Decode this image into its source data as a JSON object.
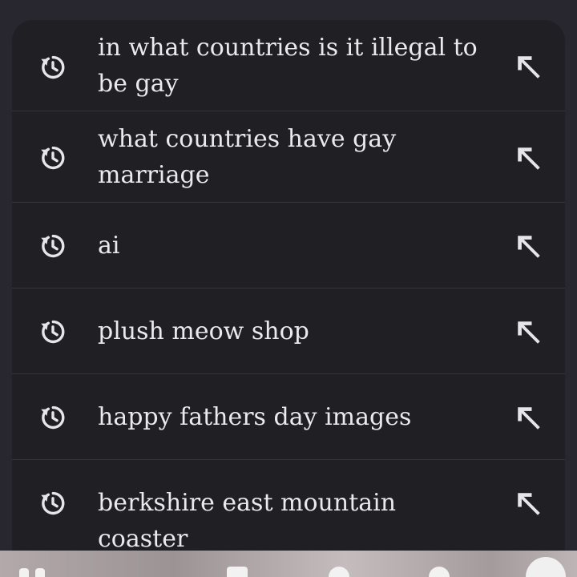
{
  "suggestions": [
    {
      "text_line1": "in what countries is it illegal to",
      "text_line2": "be gay",
      "history_icon": "history-icon",
      "fill_icon": "arrow-up-left-icon"
    },
    {
      "text_line1": "what countries have gay",
      "text_line2": "marriage",
      "history_icon": "history-icon",
      "fill_icon": "arrow-up-left-icon"
    },
    {
      "text_line1": "ai",
      "text_line2": "",
      "history_icon": "history-icon",
      "fill_icon": "arrow-up-left-icon"
    },
    {
      "text_line1": "plush meow shop",
      "text_line2": "",
      "history_icon": "history-icon",
      "fill_icon": "arrow-up-left-icon"
    },
    {
      "text_line1": "happy fathers day images",
      "text_line2": "",
      "history_icon": "history-icon",
      "fill_icon": "arrow-up-left-icon"
    },
    {
      "text_line1": "berkshire east mountain coaster",
      "text_line2": "",
      "history_icon": "history-icon",
      "fill_icon": "arrow-up-left-icon"
    }
  ],
  "colors": {
    "panel_background": "#1f1f24",
    "screen_background": "#28262f",
    "text": "#e9e9ee",
    "icon": "#e6e6ea",
    "divider": "#34343b"
  }
}
